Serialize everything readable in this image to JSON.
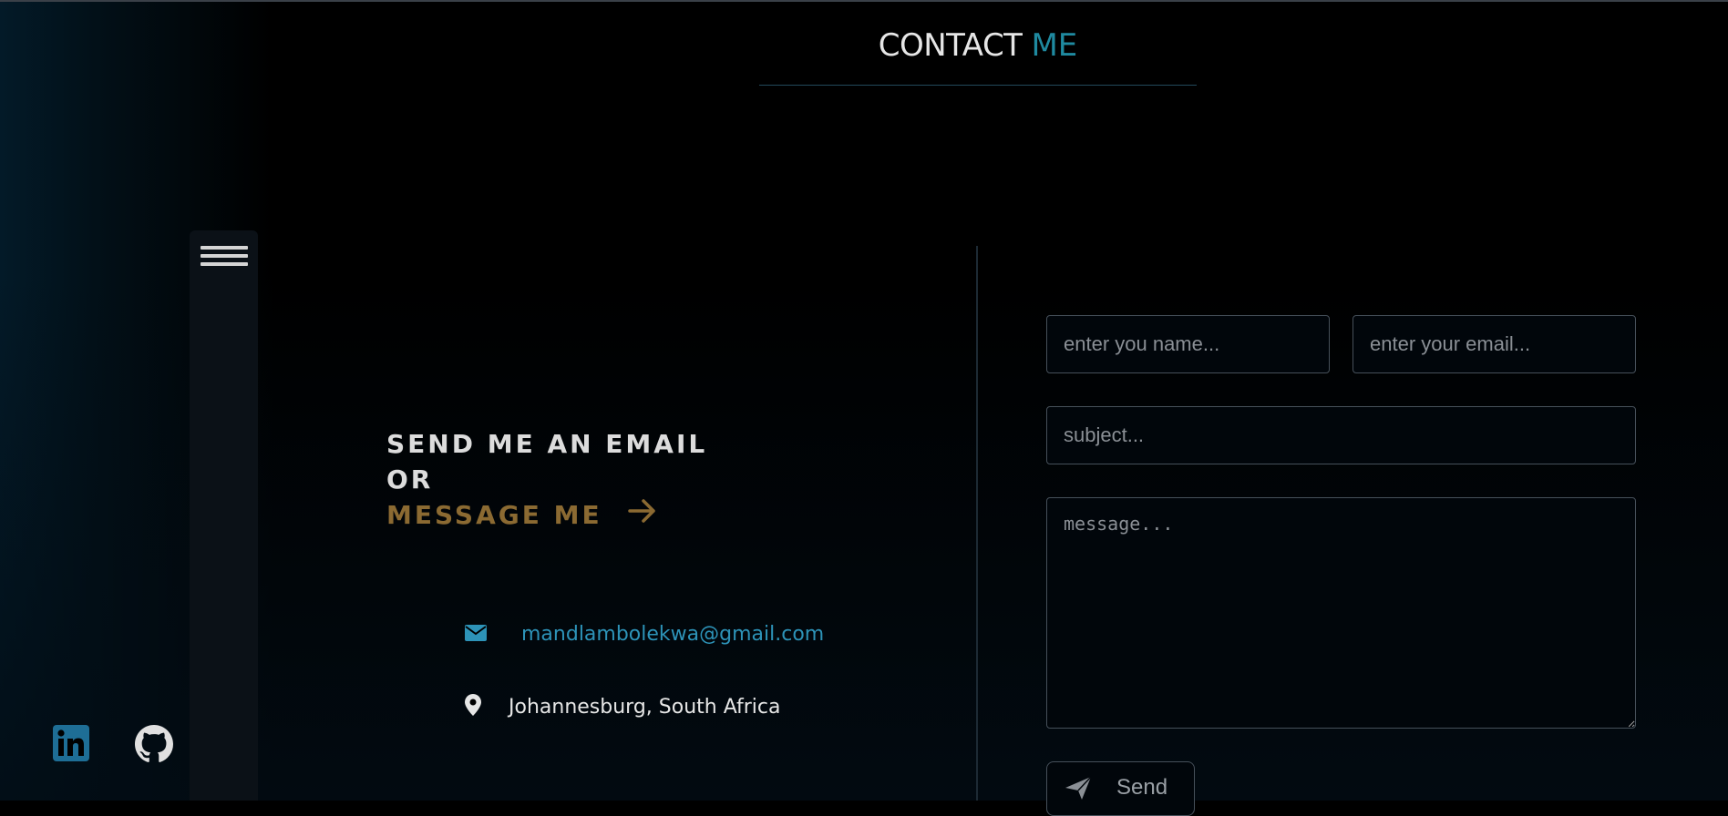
{
  "header": {
    "title_main": "CONTACT",
    "title_accent": "ME"
  },
  "sidebar": {
    "menu_icon": "hamburger-menu-icon"
  },
  "cta": {
    "line1": "SEND ME AN EMAIL",
    "line2": "OR",
    "line3": "MESSAGE ME",
    "arrow_icon": "arrow-right-icon"
  },
  "contact_info": {
    "email": "mandlambolekwa@gmail.com",
    "email_icon": "envelope-icon",
    "location": "Johannesburg, South Africa",
    "location_icon": "map-pin-icon"
  },
  "social": {
    "linkedin_icon": "linkedin-icon",
    "github_icon": "github-icon"
  },
  "form": {
    "name_placeholder": "enter you name...",
    "email_placeholder": "enter your email...",
    "subject_placeholder": "subject...",
    "message_placeholder": "message...",
    "send_label": "Send",
    "send_icon": "paper-plane-icon"
  },
  "colors": {
    "accent_blue": "#1f8aa0",
    "link_blue": "#2d93b8",
    "accent_gold": "#8b6a32",
    "background": "#000000"
  }
}
